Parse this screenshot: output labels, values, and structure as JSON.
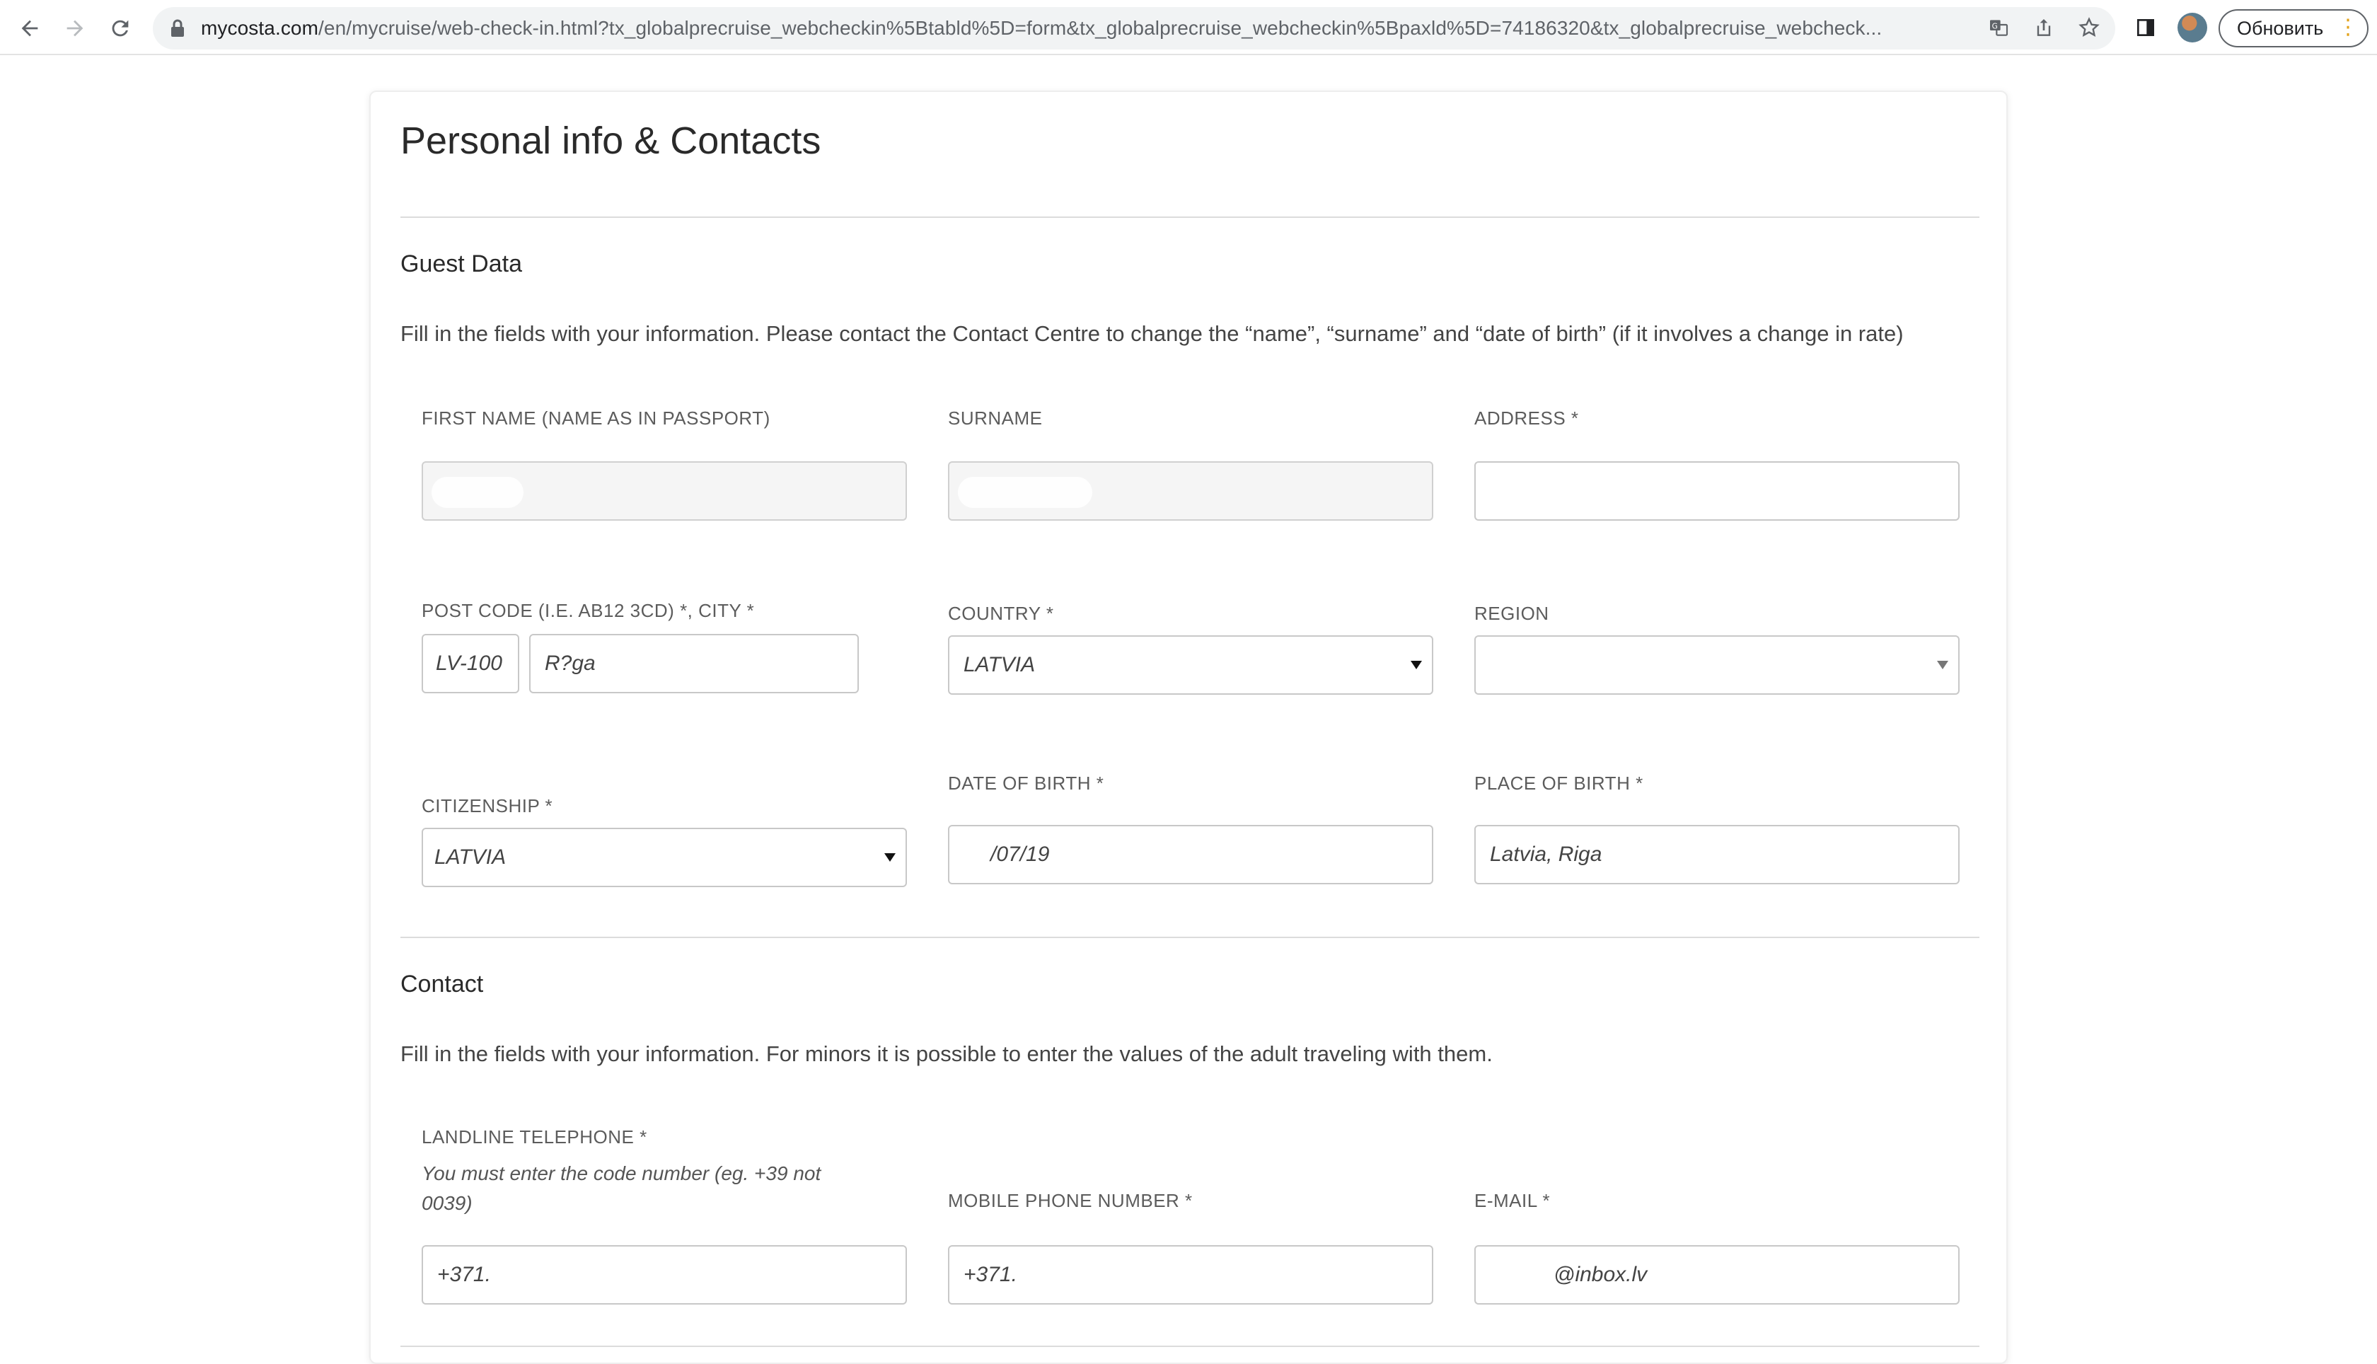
{
  "browser": {
    "url_host": "mycosta.com",
    "url_path": "/en/mycruise/web-check-in.html?tx_globalprecruise_webcheckin%5Btabld%5D=form&tx_globalprecruise_webcheckin%5Bpaxld%5D=74186320&tx_globalprecruise_webcheck...",
    "update_button": "Обновить"
  },
  "page": {
    "title": "Personal info & Contacts"
  },
  "guest": {
    "title": "Guest Data",
    "description": "Fill in the fields with your information. Please contact the Contact Centre to change the “name”, “surname” and “date of birth” (if it involves a change in rate)",
    "first_name_label": "FIRST NAME (NAME AS IN PASSPORT)",
    "surname_label": "SURNAME",
    "address_label": "ADDRESS *",
    "address_value": "",
    "postcode_city_label": "POST CODE (I.E. AB12 3CD) *, CITY *",
    "postcode_value": "LV-100",
    "city_value": "R?ga",
    "country_label": "COUNTRY *",
    "country_value": "LATVIA",
    "region_label": "REGION",
    "region_value": "",
    "citizenship_label": "CITIZENSHIP *",
    "citizenship_value": "LATVIA",
    "dob_label": "DATE OF BIRTH *",
    "dob_value": "/07/19",
    "pob_label": "PLACE OF BIRTH *",
    "pob_value": "Latvia, Riga"
  },
  "contact": {
    "title": "Contact",
    "description": "Fill in the fields with your information. For minors it is possible to enter the values of the adult traveling with them.",
    "landline_label": "LANDLINE TELEPHONE *",
    "landline_hint": "You must enter the code number (eg. +39 not 0039)",
    "landline_value": "+371.",
    "mobile_label": "MOBILE PHONE NUMBER *",
    "mobile_value": "+371.",
    "email_label": "E-MAIL *",
    "email_value": "@inbox.lv"
  }
}
